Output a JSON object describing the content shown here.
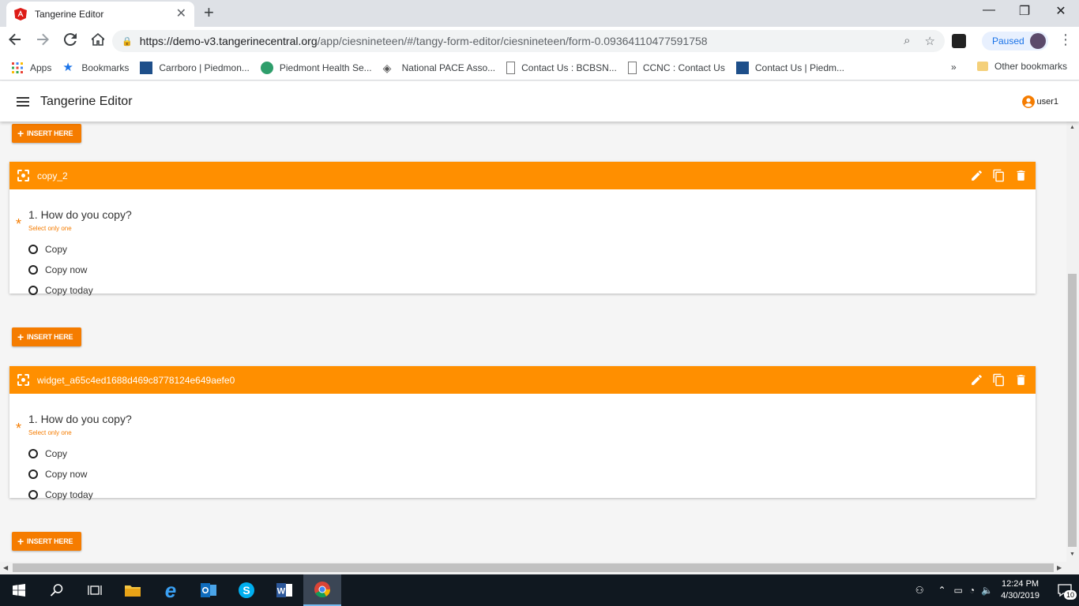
{
  "browser": {
    "tab_title": "Tangerine Editor",
    "url_host": "https://demo-v3.tangerinecentral.org",
    "url_path": "/app/ciesnineteen/#/tangy-form-editor/ciesnineteen/form-0.09364110477591758",
    "profile_status": "Paused"
  },
  "bookmarks": [
    {
      "label": "Apps",
      "icon": "apps-grid-icon"
    },
    {
      "label": "Bookmarks",
      "icon": "star-icon"
    },
    {
      "label": "Carrboro | Piedmon...",
      "icon": "site-icon"
    },
    {
      "label": "Piedmont Health Se...",
      "icon": "site-icon"
    },
    {
      "label": "National PACE Asso...",
      "icon": "site-icon"
    },
    {
      "label": "Contact Us : BCBSN...",
      "icon": "page-icon"
    },
    {
      "label": "CCNC : Contact Us",
      "icon": "page-icon"
    },
    {
      "label": "Contact Us | Piedm...",
      "icon": "site-icon"
    }
  ],
  "bookmarks_more": "»",
  "bookmarks_other": "Other bookmarks",
  "app": {
    "title": "Tangerine Editor",
    "user": "user1"
  },
  "insert_label": "INSERT HERE",
  "cards": [
    {
      "name": "copy_2",
      "question": "1. How do you copy?",
      "hint": "Select only one",
      "options": [
        "Copy",
        "Copy now",
        "Copy today"
      ]
    },
    {
      "name": "widget_a65c4ed1688d469c8778124e649aefe0",
      "question": "1. How do you copy?",
      "hint": "Select only one",
      "options": [
        "Copy",
        "Copy now",
        "Copy today"
      ]
    }
  ],
  "required_mark": "*",
  "taskbar": {
    "time": "12:24 PM",
    "date": "4/30/2019",
    "notifications": "10"
  },
  "colors": {
    "accent": "#ff8f00",
    "button": "#f57c00"
  }
}
